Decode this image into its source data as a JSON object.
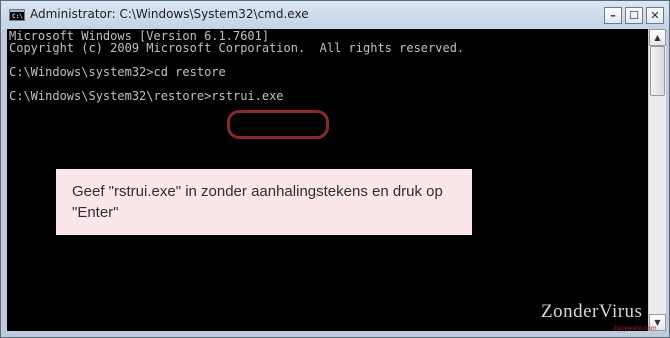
{
  "window": {
    "title": "Administrator: C:\\Windows\\System32\\cmd.exe",
    "icon_label": "C:\\",
    "minimize_glyph": "–",
    "maximize_glyph": "☐",
    "close_glyph": "✕"
  },
  "console": {
    "lines": [
      "Microsoft Windows [Version 6.1.7601]",
      "Copyright (c) 2009 Microsoft Corporation.  All rights reserved.",
      "",
      "C:\\Windows\\system32>cd restore",
      "",
      "C:\\Windows\\System32\\restore>rstrui.exe"
    ],
    "text_color": "#c0c0c0",
    "background": "#000000"
  },
  "callout": {
    "text": "Geef \"rstrui.exe\" in zonder aanhalingstekens en druk op \"Enter\"",
    "background": "#fbe7e9",
    "ring_color": "#8b2a2a"
  },
  "scrollbar": {
    "up_glyph": "▲",
    "down_glyph": "▼"
  },
  "watermark": {
    "brand": "ZonderVirus",
    "sub": "2spyware.com"
  }
}
